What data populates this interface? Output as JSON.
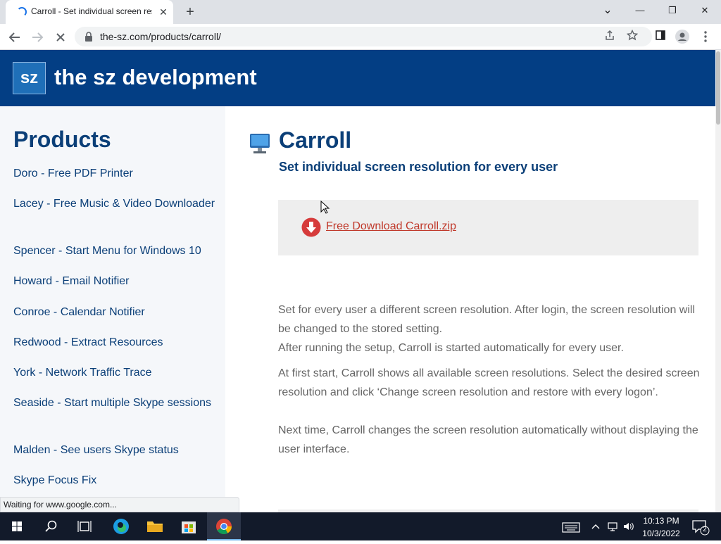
{
  "browser": {
    "tab_title": "Carroll - Set individual screen res",
    "tab_close": "✕",
    "new_tab": "+",
    "url": "the-sz.com/products/carroll/",
    "status": "Waiting for www.google.com...",
    "win_minimize": "—",
    "win_restore": "❐",
    "win_close": "✕",
    "tab_list": "⌄"
  },
  "site": {
    "logo": "sz",
    "title": "the sz development"
  },
  "sidebar": {
    "heading": "Products",
    "items": [
      {
        "label": "Doro - Free PDF Printer"
      },
      {
        "label": "Lacey - Free Music & Video Downloader"
      },
      {
        "label": "Spencer - Start Menu for Windows 10"
      },
      {
        "label": "Howard - Email Notifier"
      },
      {
        "label": "Conroe - Calendar Notifier"
      },
      {
        "label": "Redwood - Extract Resources"
      },
      {
        "label": "York - Network Traffic Trace"
      },
      {
        "label": "Seaside - Start multiple Skype sessions"
      },
      {
        "label": "Malden - See users Skype status"
      },
      {
        "label": "Skype Focus Fix"
      }
    ]
  },
  "main": {
    "title": "Carroll",
    "subtitle": "Set individual screen resolution for every user",
    "download_label": "Free Download Carroll.zip",
    "paragraphs": [
      "Set for every user a different screen resolution. After login, the screen resolution will be changed to the stored setting.",
      "After running the setup, Carroll is started automatically for every user.",
      "At first start, Carroll shows all available screen resolutions. Select the desired screen resolution and click ‘Change screen resolution and restore with every logon’.",
      "Next time, Carroll changes the screen resolution automatically without displaying the user interface."
    ]
  },
  "taskbar": {
    "time": "10:13 PM",
    "date": "10/3/2022",
    "notification_count": "2"
  },
  "colors": {
    "brand": "#033e84",
    "link": "#0b3f78",
    "download": "#c0392b"
  }
}
